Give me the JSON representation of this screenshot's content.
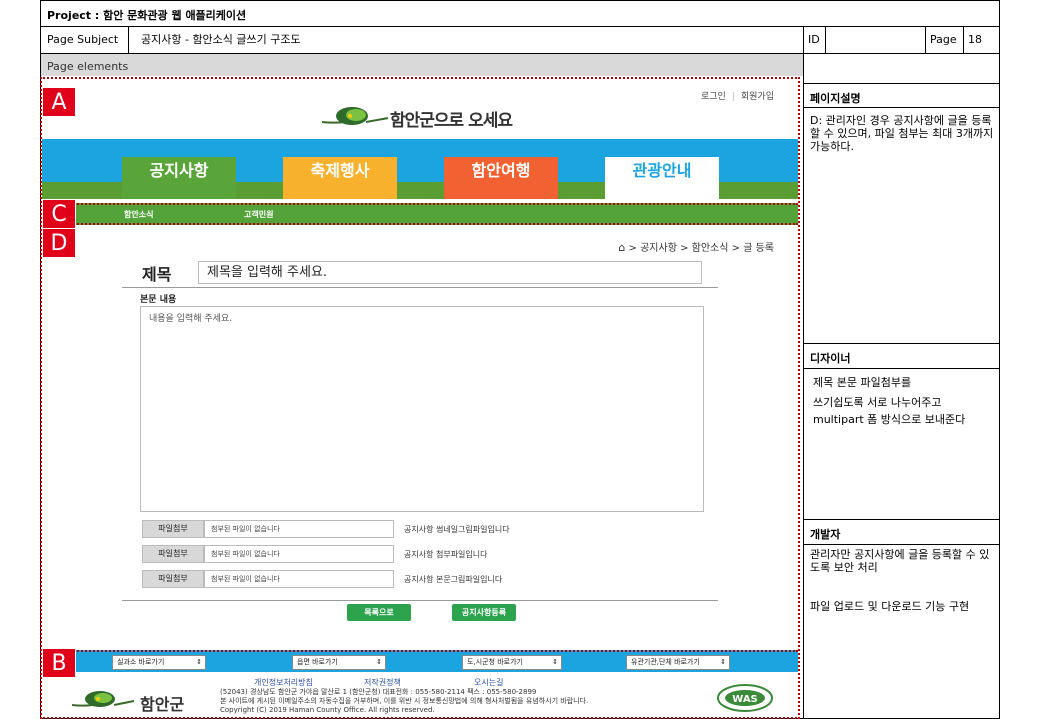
{
  "storyboard": {
    "project_title": "Project : 함안 문화관광 웹 애플리케이션",
    "page_subject_label": "Page Subject",
    "page_subject": "공지사항 - 함안소식 글쓰기 구조도",
    "id_label": "ID",
    "id_value": "",
    "page_label": "Page",
    "page_number": "18",
    "page_elements_label": "Page elements"
  },
  "side_panel": {
    "description_title": "페이지설명",
    "description_text": "D: 관리자인 경우 공지사항에 글을 등록할 수 있으며, 파일 첨부는 최대 3개까지 가능하다.",
    "designer_title": "디자이너",
    "designer_lines": [
      "제목 본문 파일첨부를",
      "쓰기쉽도록 서로 나누어주고",
      "multipart 폼 방식으로 보내준다"
    ],
    "developer_title": "개발자",
    "developer_text_1": "관리자만 공지사항에 글을 등록할 수 있도록 보안 처리",
    "developer_text_2": "파일 업로드 및 다운로드 기능 구현"
  },
  "badges": {
    "a": "A",
    "b": "B",
    "c": "C",
    "d": "D"
  },
  "header": {
    "login": "로그인",
    "join": "회원가입",
    "logo_text": "함안군으로 오세요"
  },
  "nav": {
    "items": [
      {
        "label": "공지사항",
        "color": "#5aa53a"
      },
      {
        "label": "축제행사",
        "color": "#f7b12d"
      },
      {
        "label": "함안여행",
        "color": "#f26132"
      },
      {
        "label": "관광안내",
        "color": "#ffffff"
      }
    ],
    "active_text_color": "#1ba4df"
  },
  "subnav": {
    "items": [
      "함안소식",
      "고객민원"
    ]
  },
  "breadcrumb": {
    "items": [
      "공지사항",
      "함안소식",
      "글 등록"
    ]
  },
  "form": {
    "title_label": "제목",
    "title_placeholder": "제목을 입력해 주세요.",
    "body_label": "본문 내용",
    "body_placeholder": "내용을 입력해 주세요.",
    "files": [
      {
        "button": "파일첨부",
        "placeholder": "첨부된 파일이 없습니다",
        "desc": "공지사항 썸네일그림파일입니다"
      },
      {
        "button": "파일첨부",
        "placeholder": "첨부된 파일이 없습니다",
        "desc": "공지사항 첨부파일입니다"
      },
      {
        "button": "파일첨부",
        "placeholder": "첨부된 파일이 없습니다",
        "desc": "공지사항 본문그림파일입니다"
      }
    ],
    "list_button": "목록으로",
    "submit_button": "공지사항등록"
  },
  "footer": {
    "selects": [
      "실과소 바로가기",
      "읍면 바로가기",
      "도,시군청 바로가기",
      "유관기관,단체 바로가기"
    ],
    "links": [
      "개인정보처리방침",
      "저작권정책",
      "오시는길"
    ],
    "address_line": "(52043) 경상남도 함안군 가야읍 말산로 1 (함안군청)    대표전화 : 055-580-2114    팩스 : 055-580-2899",
    "notice_line": "본 사이트에 게시된 이메일주소의 자동수집을 거부하며, 이를 위반 시 정보통신망법에 의해 형사처벌됨을 유념하시기 바랍니다.",
    "copyright": "Copyright (C) 2019 Haman County Office. All rights reserved.",
    "logo_text": "함안군",
    "was_text": "WAS"
  }
}
